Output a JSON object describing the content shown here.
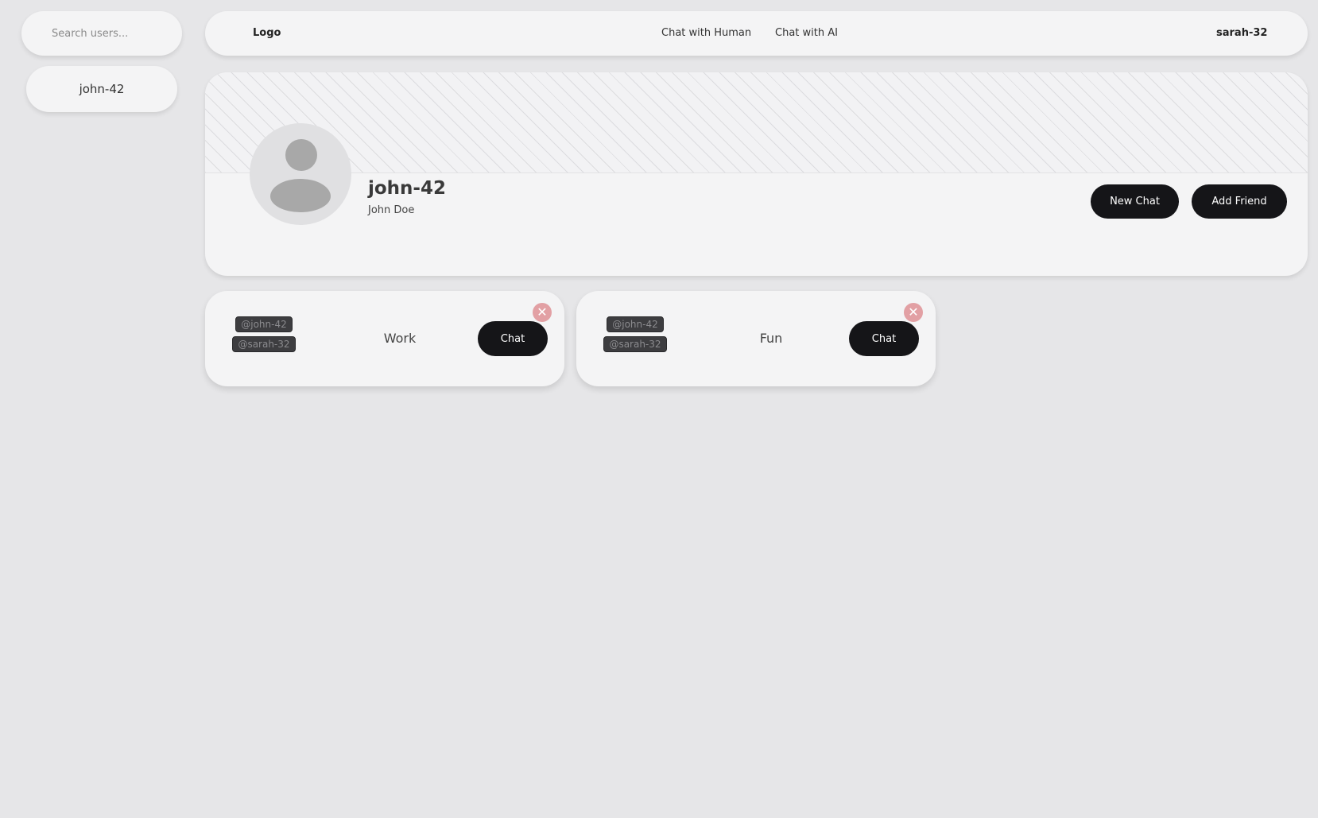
{
  "sidebar": {
    "search_placeholder": "Search users...",
    "users": [
      {
        "label": "john-42"
      }
    ]
  },
  "header": {
    "logo": "Logo",
    "nav": [
      {
        "label": "Chat with Human"
      },
      {
        "label": "Chat with AI"
      }
    ],
    "current_user": "sarah-32"
  },
  "profile": {
    "username": "john-42",
    "full_name": "John Doe",
    "new_chat_label": "New Chat",
    "add_friend_label": "Add Friend",
    "avatar_icon": "user-placeholder-icon"
  },
  "chats": [
    {
      "members": [
        "@john-42",
        "@sarah-32"
      ],
      "name": "Work",
      "button_label": "Chat",
      "close_icon": "close-icon"
    },
    {
      "members": [
        "@john-42",
        "@sarah-32"
      ],
      "name": "Fun",
      "button_label": "Chat",
      "close_icon": "close-icon"
    }
  ],
  "colors": {
    "background": "#e6e6e8",
    "surface": "#f4f4f5",
    "button_dark": "#151518",
    "close_badge": "#e2a0a4",
    "tag_bg": "#3d3d40"
  }
}
